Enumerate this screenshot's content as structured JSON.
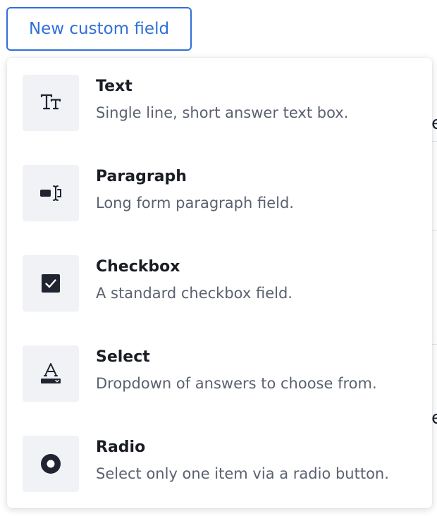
{
  "button": {
    "label": "New custom field"
  },
  "menu": {
    "items": [
      {
        "title": "Text",
        "description": "Single line, short answer text box.",
        "icon": "text-type-icon"
      },
      {
        "title": "Paragraph",
        "description": "Long form paragraph field.",
        "icon": "paragraph-cursor-icon"
      },
      {
        "title": "Checkbox",
        "description": "A standard checkbox field.",
        "icon": "checkbox-icon"
      },
      {
        "title": "Select",
        "description": "Dropdown of answers to choose from.",
        "icon": "select-dropdown-icon"
      },
      {
        "title": "Radio",
        "description": "Select only one item via a radio button.",
        "icon": "radio-icon"
      }
    ]
  },
  "colors": {
    "accent": "#2f6fd8",
    "title_text": "#1a1d24",
    "description_text": "#5a6170",
    "icon_tile_bg": "#f1f2f5",
    "icon_fg": "#1f2430"
  }
}
